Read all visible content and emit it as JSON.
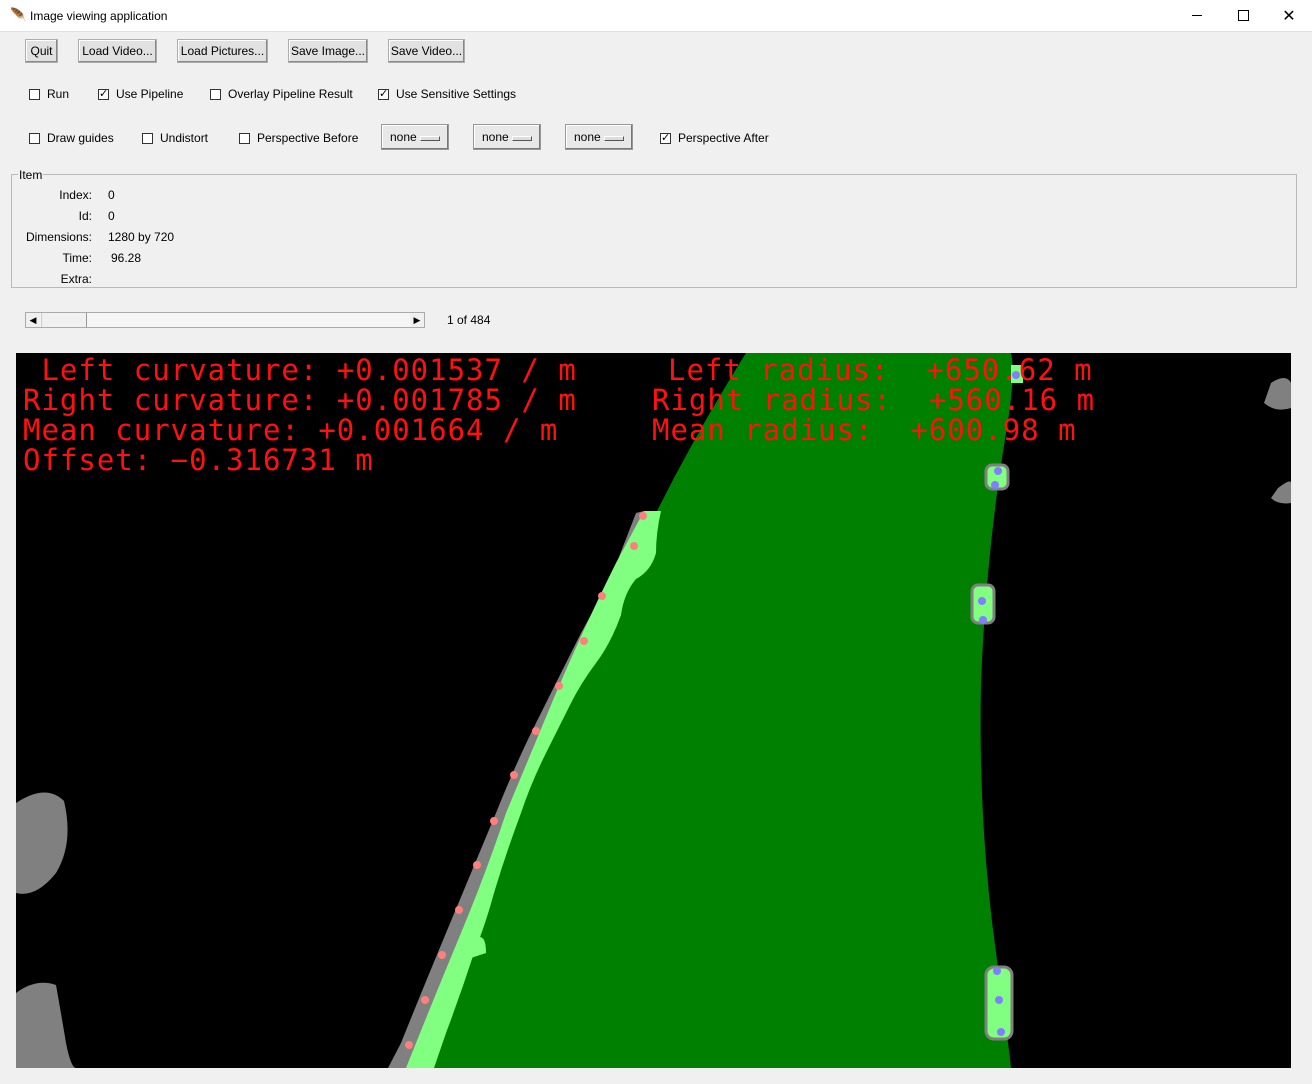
{
  "window": {
    "title": "Image viewing application",
    "app_icon": "feather-icon"
  },
  "toolbar": {
    "quit": "Quit",
    "load_video": "Load Video...",
    "load_pictures": "Load Pictures...",
    "save_image": "Save Image...",
    "save_video": "Save Video..."
  },
  "options_row1": [
    {
      "label": "Run",
      "checked": false
    },
    {
      "label": "Use Pipeline",
      "checked": true
    },
    {
      "label": "Overlay Pipeline Result",
      "checked": false
    },
    {
      "label": "Use Sensitive Settings",
      "checked": true
    }
  ],
  "options_row2": {
    "draw_guides": {
      "label": "Draw guides",
      "checked": false
    },
    "undistort": {
      "label": "Undistort",
      "checked": false
    },
    "perspective_before": {
      "label": "Perspective Before",
      "checked": false
    },
    "perspective_after": {
      "label": "Perspective After",
      "checked": true
    },
    "menu1": "none",
    "menu2": "none",
    "menu3": "none"
  },
  "item": {
    "legend": "Item",
    "index_label": "Index:",
    "index_value": "0",
    "id_label": "Id:",
    "id_value": "0",
    "dims_label": "Dimensions:",
    "dims_value": "1280 by 720",
    "time_label": "Time:",
    "time_value": "96.28",
    "extra_label": "Extra:",
    "extra_value": ""
  },
  "slider": {
    "position_text": "1 of 484",
    "current": 1,
    "total": 484
  },
  "overlay": {
    "left_curv": " Left curvature: +0.001537 / m",
    "right_curv": "Right curvature: +0.001785 / m",
    "mean_curv": "Mean curvature: +0.001664 / m",
    "offset": "Offset: −0.316731 m",
    "left_radius": "Left radius:  +650.62 m",
    "right_radius": "Right radius:  +560.16 m",
    "mean_radius": "Mean radius:  +600.98 m"
  },
  "colors": {
    "lane_fill": "#008000",
    "lane_line": "#80ff80",
    "blob": "#808080",
    "left_points": "#ff7f7f",
    "right_points": "#7f7fff",
    "text": "#ff1111"
  }
}
